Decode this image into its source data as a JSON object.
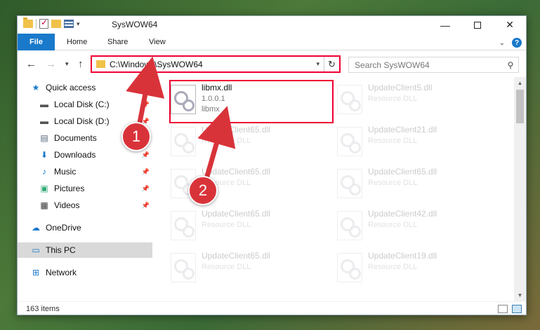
{
  "window": {
    "title": "SysWOW64"
  },
  "ribbon": {
    "file": "File",
    "home": "Home",
    "share": "Share",
    "view": "View"
  },
  "address": {
    "path": "C:\\Windows\\SysWOW64"
  },
  "search": {
    "placeholder": "Search SysWOW64"
  },
  "navpane": {
    "items": [
      {
        "label": "Quick access",
        "icon": "star-icon"
      },
      {
        "label": "Local Disk (C:)",
        "icon": "drive-icon"
      },
      {
        "label": "Local Disk (D:)",
        "icon": "drive-icon"
      },
      {
        "label": "Documents",
        "icon": "documents-icon"
      },
      {
        "label": "Downloads",
        "icon": "download-icon"
      },
      {
        "label": "Music",
        "icon": "music-icon"
      },
      {
        "label": "Pictures",
        "icon": "pictures-icon"
      },
      {
        "label": "Videos",
        "icon": "videos-icon"
      },
      {
        "label": "OneDrive",
        "icon": "cloud-icon"
      },
      {
        "label": "This PC",
        "icon": "computer-icon"
      },
      {
        "label": "Network",
        "icon": "network-icon"
      }
    ]
  },
  "files": [
    {
      "name": "libmx.dll",
      "line2": "1.0.0.1",
      "line3": "libmx"
    },
    {
      "name": "UpdateClient5.dll",
      "line2": "Resource DLL"
    },
    {
      "name": "UpdateClient65.dll",
      "line2": "Resource DLL"
    },
    {
      "name": "UpdateClient21.dll",
      "line2": "Resource DLL"
    },
    {
      "name": "UpdateClient65.dll",
      "line2": "Resource DLL"
    },
    {
      "name": "UpdateClient65.dll",
      "line2": "Resource DLL"
    },
    {
      "name": "UpdateClient65.dll",
      "line2": "Resource DLL"
    },
    {
      "name": "UpdateClient42.dll",
      "line2": "Resource DLL"
    },
    {
      "name": "UpdateClient65.dll",
      "line2": "Resource DLL"
    },
    {
      "name": "UpdateClient19.dll",
      "line2": "Resource DLL"
    }
  ],
  "status": {
    "count": "163 items"
  },
  "callouts": {
    "one": "1",
    "two": "2"
  },
  "colors": {
    "accent": "#1979ca",
    "highlight": "#e00033",
    "callout": "#d9333a"
  }
}
